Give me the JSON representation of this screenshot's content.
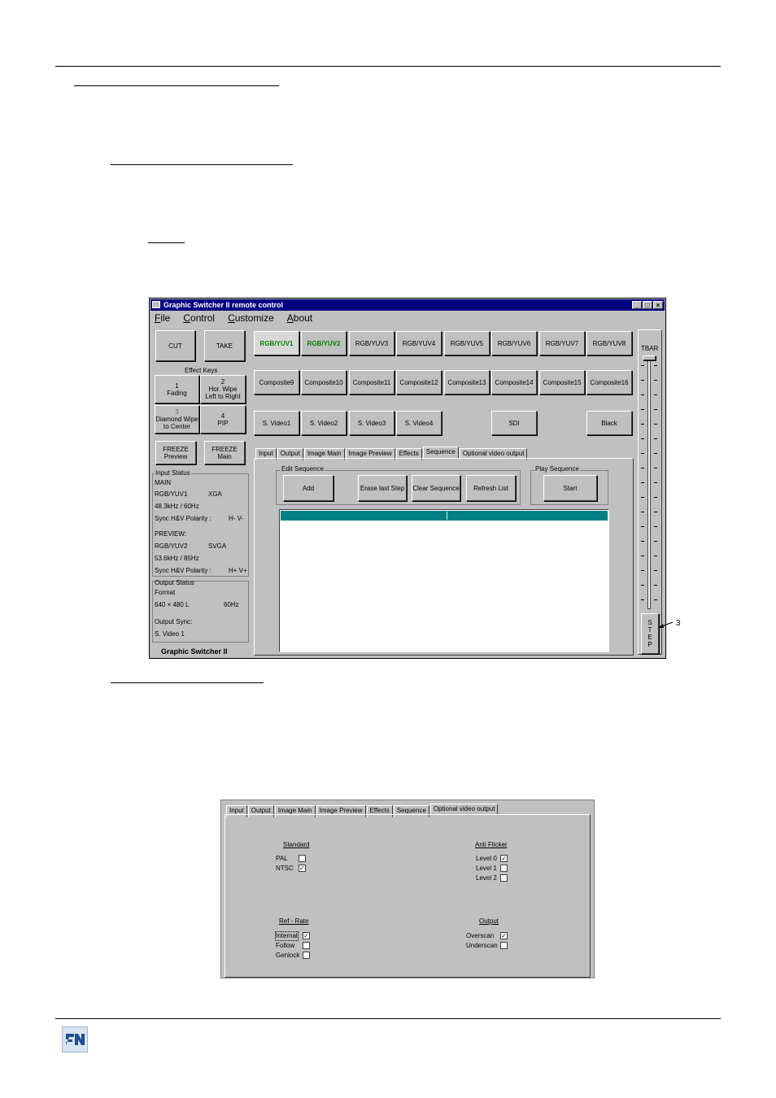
{
  "window": {
    "title": "Graphic Switcher II remote control",
    "menu": [
      "File",
      "Control",
      "Customize",
      "About"
    ],
    "controls": {
      "cut": "CUT",
      "take": "TAKE",
      "effect_keys": "Effect Keys",
      "effects": [
        {
          "num": "1",
          "label": "Fading"
        },
        {
          "num": "2",
          "label": "Hor. Wipe Left to Right"
        },
        {
          "num": "3",
          "label": "Diamond Wipe to Center"
        },
        {
          "num": "4",
          "label": "PIP"
        }
      ],
      "freeze_preview": "FREEZE Preview",
      "freeze_main": "FREEZE Main"
    },
    "inputs_row1": [
      "RGB/YUV1",
      "RGB/YUV2",
      "RGB/YUV3",
      "RGB/YUV4",
      "RGB/YUV5",
      "RGB/YUV6",
      "RGB/YUV7",
      "RGB/YUV8"
    ],
    "inputs_row2": [
      "Composite9",
      "Composite10",
      "Composite11",
      "Composite12",
      "Composite13",
      "Composite14",
      "Composite15",
      "Composite16"
    ],
    "inputs_row3": [
      "S. Video1",
      "S. Video2",
      "S. Video3",
      "S. Video4"
    ],
    "sdi": "SDI",
    "black": "Black",
    "input_status": {
      "title": "Input Status",
      "main_label": "MAIN",
      "main_src": "RGB/YUV1",
      "main_fmt": "XGA",
      "main_freq": "48.3kHz / 60Hz",
      "main_sync_label": "Sync H&V Polarity :",
      "main_sync": "H- V-",
      "preview_label": "PREVIEW:",
      "prev_src": "RGB/YUV2",
      "prev_fmt": "SVGA",
      "prev_freq": "53.6kHz / 85Hz",
      "prev_sync_label": "Sync H&V Polarity :",
      "prev_sync": "H+ V+"
    },
    "output_status": {
      "title": "Output Status",
      "format_label": "Format",
      "format": "640 × 480  L",
      "rate": "60Hz",
      "sync_label": "Output Sync:",
      "sync": "S. Video 1"
    },
    "footer": "Graphic Switcher II",
    "tabs": [
      "Input",
      "Output",
      "Image Main",
      "Image Preview",
      "Effects",
      "Sequence",
      "Optional video output"
    ],
    "active_tab": "Sequence",
    "edit_sequence": {
      "title": "Edit Sequence",
      "add": "Add",
      "erase": "Erase last Step",
      "clear": "Clear Sequence",
      "refresh": "Refresh List"
    },
    "play_sequence": {
      "title": "Play Sequence",
      "start": "Start"
    },
    "tbar": "TBAR",
    "step": [
      "S",
      "T",
      "E",
      "P"
    ],
    "callout": "3"
  },
  "window2": {
    "tabs": [
      "Input",
      "Output",
      "Image Main",
      "Image Preview",
      "Effects",
      "Sequence",
      "Optional video output"
    ],
    "standard": {
      "title": "Standard",
      "pal": "PAL",
      "ntsc": "NTSC",
      "pal_checked": false,
      "ntsc_checked": true
    },
    "anti_flicker": {
      "title": "Anti Flicker",
      "level0": "Level 0",
      "level1": "Level 1",
      "level2": "Level 2",
      "checked": "Level 0"
    },
    "ref_rate": {
      "title": "Ref - Rate",
      "internal": "Internal",
      "follow": "Follow",
      "genlock": "Genlock",
      "checked": "Internal"
    },
    "output": {
      "title": "Output",
      "overscan": "Overscan",
      "underscan": "Underscan",
      "checked": "Overscan"
    }
  }
}
